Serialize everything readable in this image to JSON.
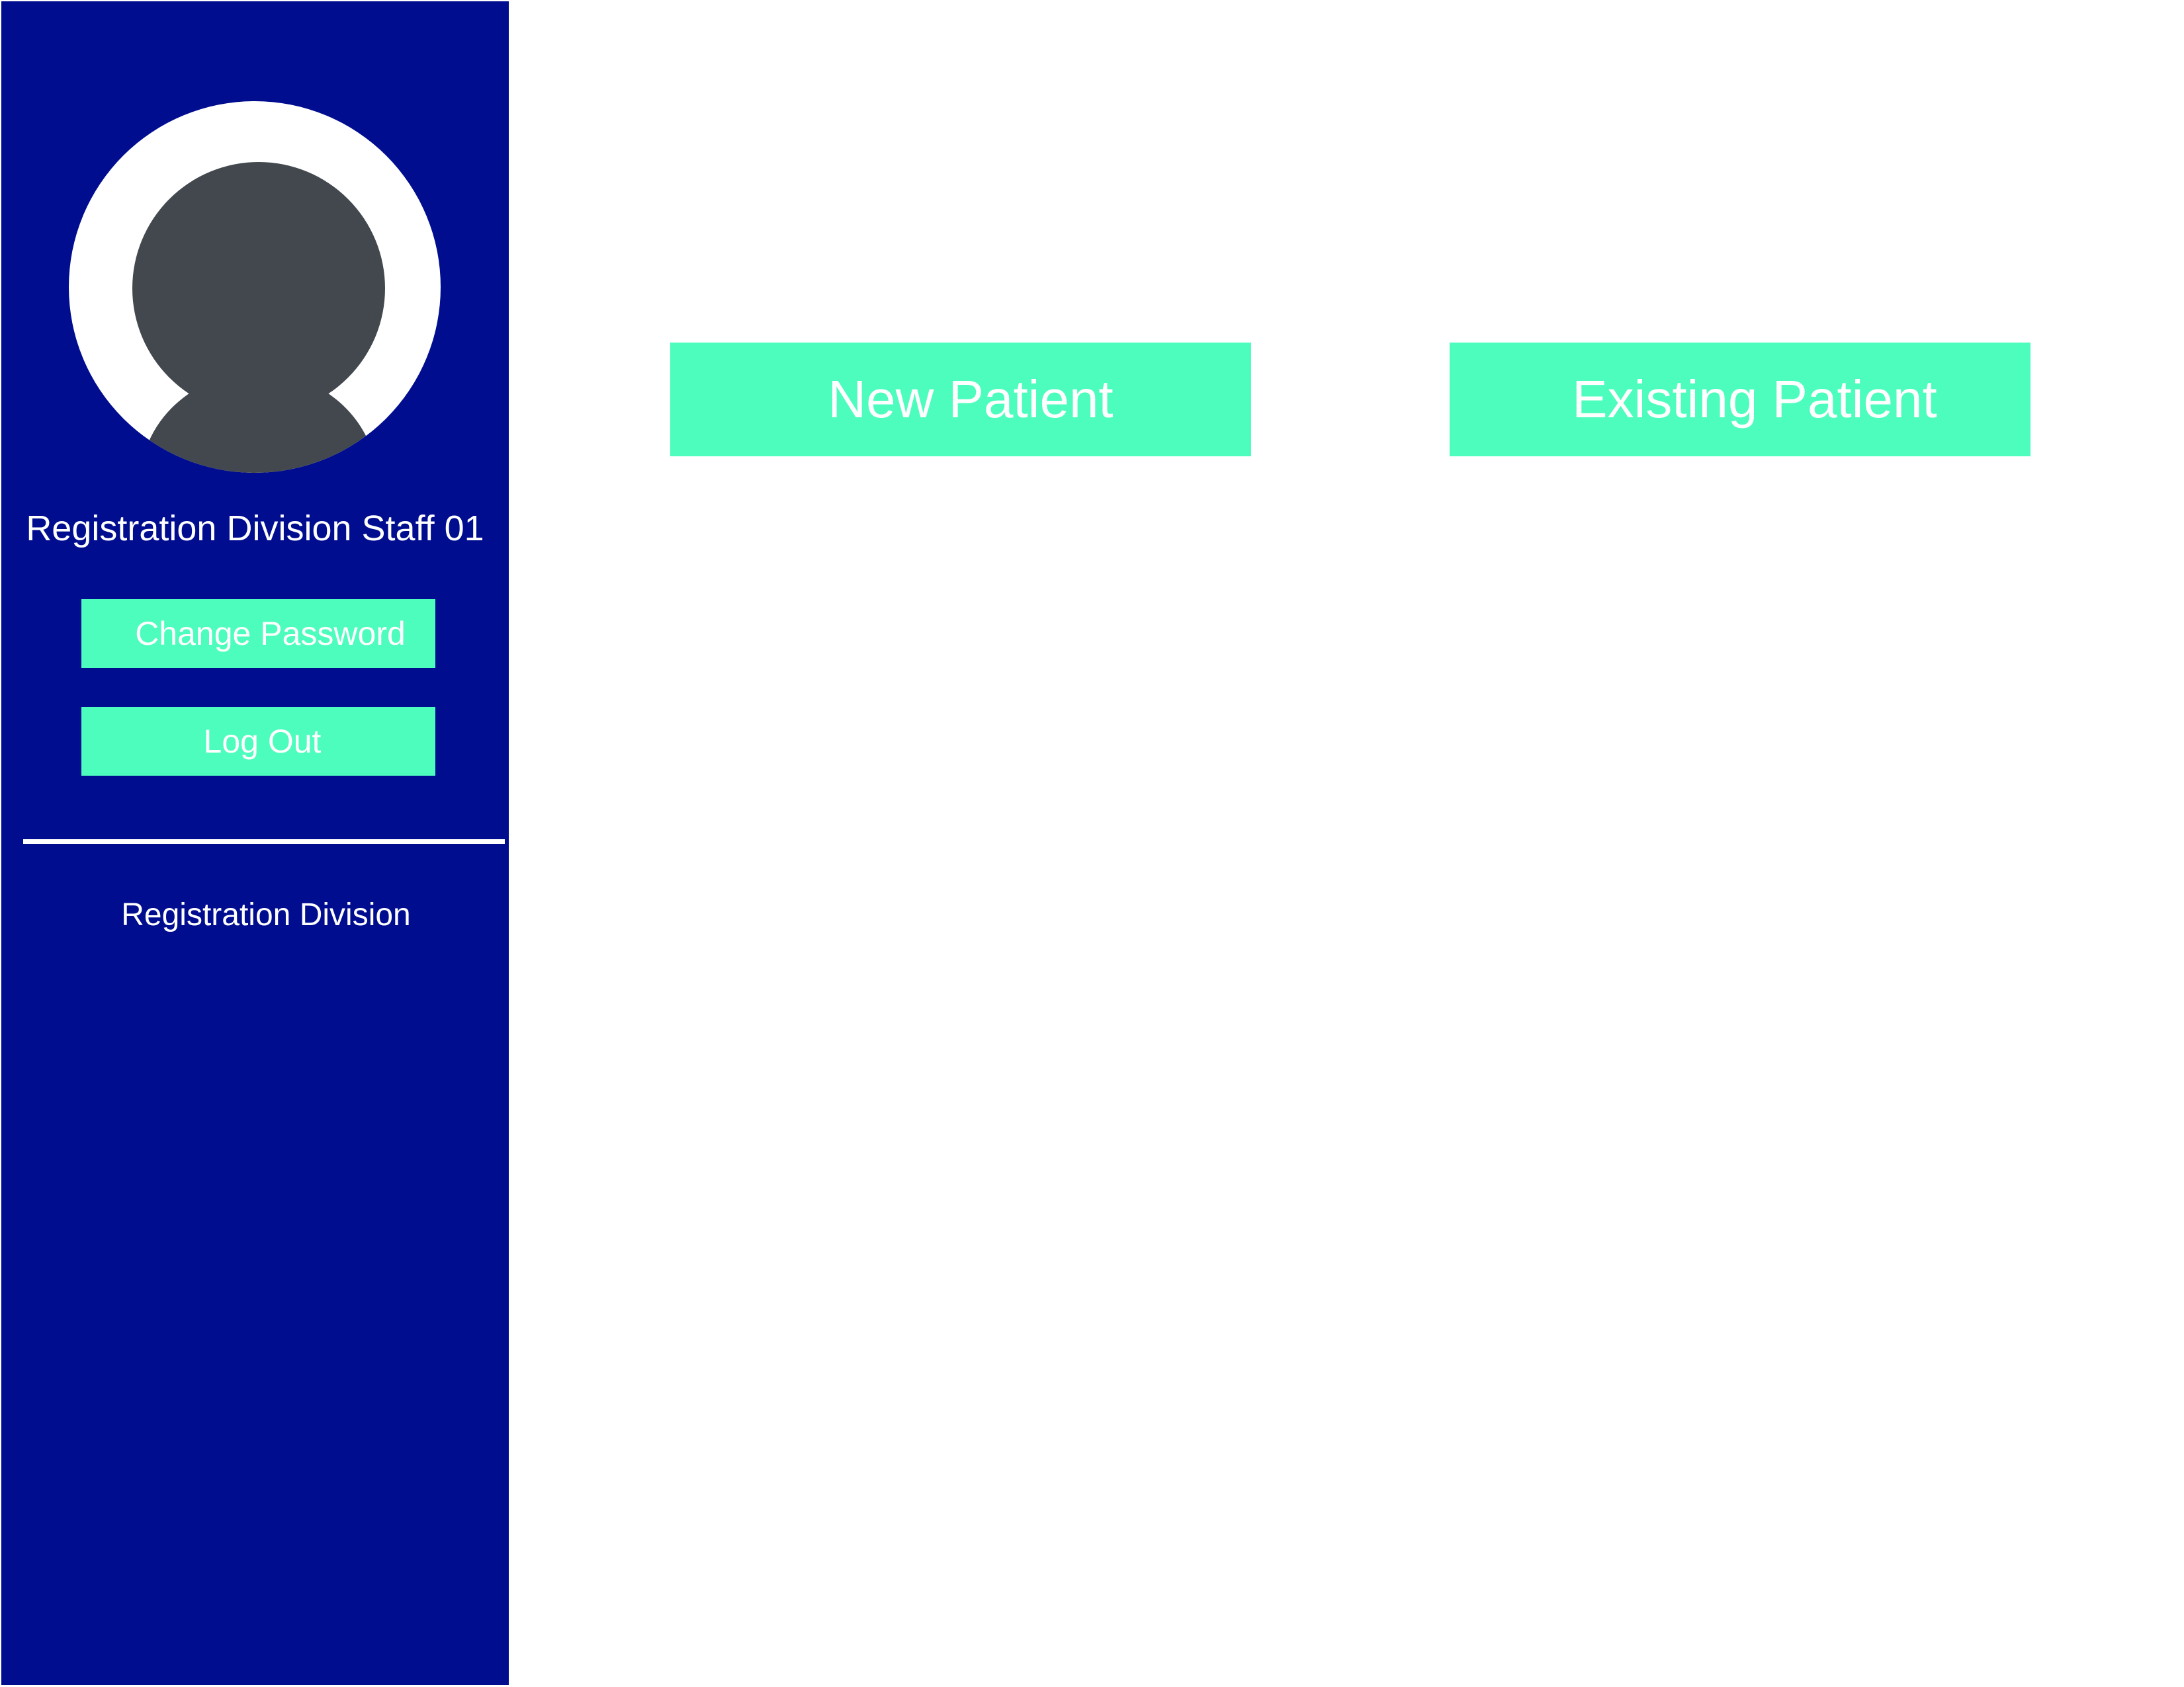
{
  "sidebar": {
    "avatar_icon": "user-avatar-icon",
    "staff_name": "Registration Division Staff 01",
    "change_password_label": "Change Password",
    "logout_label": "Log Out",
    "division_label": "Registration Division",
    "background_color": "#000d8f"
  },
  "main": {
    "new_patient_label": "New Patient",
    "existing_patient_label": "Existing Patient",
    "button_color": "#4dfdbd"
  }
}
